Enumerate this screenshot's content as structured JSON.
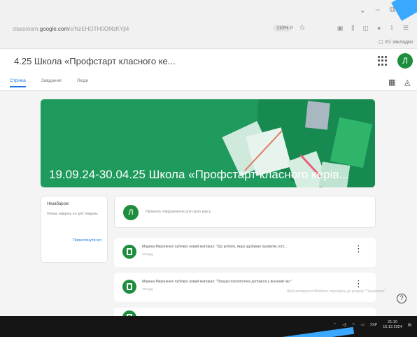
{
  "browser": {
    "address_prefix": "classroom.",
    "address_domain": "google.com",
    "address_suffix": "/c/NzEHOTH0OMzKYjl4",
    "zoom": "110%",
    "bookmark_label": "Усі закладки"
  },
  "header": {
    "course_title": "4.25 Школа «Профстарт класного ке...",
    "avatar_letter": "Л",
    "tabs": [
      "Стрічка",
      "Завдання",
      "Люди"
    ]
  },
  "banner": {
    "title": "19.09.24-30.04.25 Школа «Профстарт класного керів..."
  },
  "upcoming": {
    "title": "Незабаром",
    "text": "Немає завдань на цей тиждень",
    "link": "Переглянути всі"
  },
  "announce": {
    "avatar_letter": "Л",
    "placeholder": "Напишіть повідомлення для свого курсу"
  },
  "stream": [
    {
      "text": "Марина Мироненко публікує новий матеріал: \"Що робити, якщо здобувач проявляє гост...",
      "date": "13 груд."
    },
    {
      "text": "Марина Мироненко публікує новий матеріал: \"Перша психологічна допомога у воєнний час\"",
      "date": "13 груд."
    }
  ],
  "windows": {
    "activation": "Щоб активувати Windows, перейдіть до розділу \"Параметри\".",
    "lang": "УКР",
    "time": "21:10",
    "date": "15.12.2024"
  },
  "colors": {
    "brand_green": "#1e9a5c",
    "accent_blue": "#1a73e8"
  }
}
